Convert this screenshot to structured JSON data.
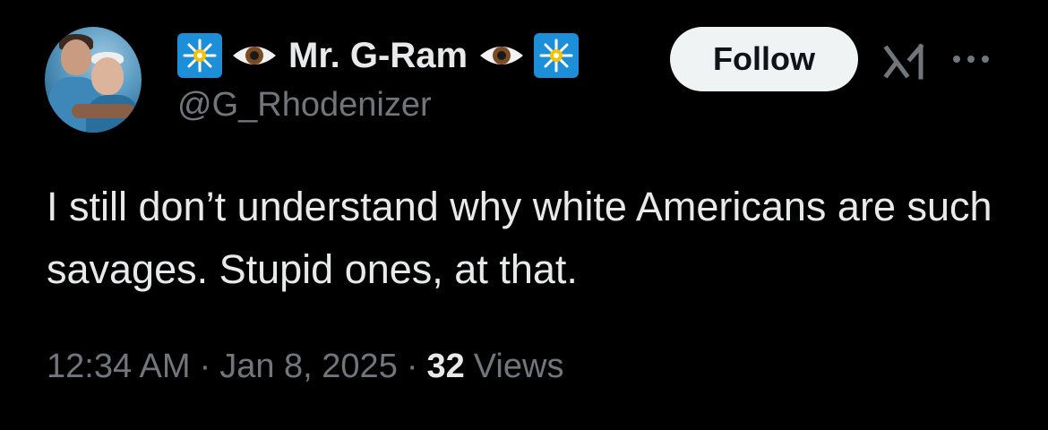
{
  "user": {
    "display_name": "Mr. G-Ram",
    "handle": "@G_Rhodenizer",
    "name_emojis": [
      "sparkle-burst-icon",
      "eye-icon",
      "eye-icon",
      "sparkle-burst-icon"
    ]
  },
  "actions": {
    "follow_label": "Follow"
  },
  "tweet": {
    "text": "I still don’t understand why white Americans are such savages. Stupid ones, at that.",
    "time": "12:34 AM",
    "separator": "·",
    "date": "Jan 8, 2025",
    "views_count": "32",
    "views_label": "Views"
  },
  "colors": {
    "background": "#000000",
    "primary_text": "#e7e9ea",
    "secondary_text": "#71767b",
    "follow_bg": "#eff3f4"
  }
}
